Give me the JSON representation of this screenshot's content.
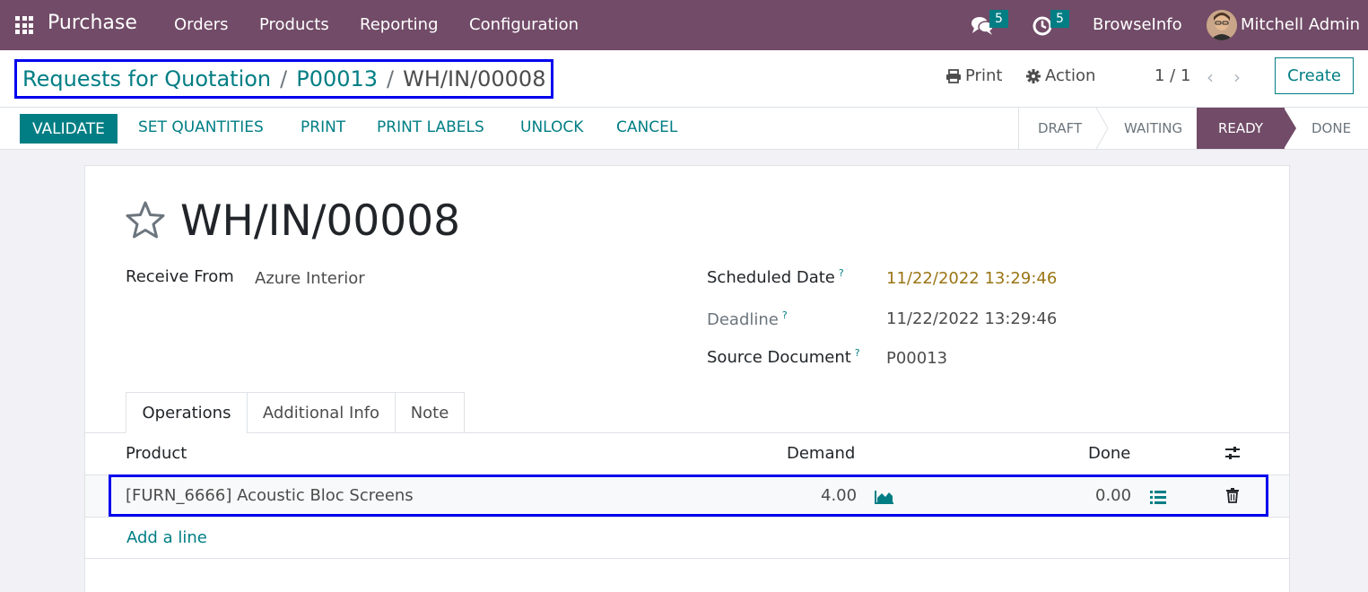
{
  "navbar": {
    "app_name": "Purchase",
    "menu": [
      "Orders",
      "Products",
      "Reporting",
      "Configuration"
    ],
    "messages_count": "5",
    "activities_count": "5",
    "company": "BrowseInfo",
    "user": "Mitchell Admin"
  },
  "breadcrumb": {
    "items": [
      "Requests for Quotation",
      "P00013"
    ],
    "current": "WH/IN/00008",
    "separator": "/"
  },
  "control_panel": {
    "print_label": "Print",
    "action_label": "Action",
    "pager": "1 / 1",
    "create_label": "Create"
  },
  "statusbar": {
    "buttons": {
      "validate": "VALIDATE",
      "set_quantities": "SET QUANTITIES",
      "print": "PRINT",
      "print_labels": "PRINT LABELS",
      "unlock": "UNLOCK",
      "cancel": "CANCEL"
    },
    "stages": [
      "DRAFT",
      "WAITING",
      "READY",
      "DONE"
    ],
    "current_stage": "READY"
  },
  "record": {
    "title": "WH/IN/00008",
    "fields": {
      "receive_from_label": "Receive From",
      "receive_from": "Azure Interior",
      "scheduled_date_label": "Scheduled Date",
      "scheduled_date": "11/22/2022 13:29:46",
      "deadline_label": "Deadline",
      "deadline": "11/22/2022 13:29:46",
      "source_document_label": "Source Document",
      "source_document": "P00013",
      "help_mark": "?"
    }
  },
  "tabs": [
    "Operations",
    "Additional Info",
    "Note"
  ],
  "table": {
    "columns": [
      "Product",
      "Demand",
      "Done"
    ],
    "rows": [
      {
        "product": "[FURN_6666] Acoustic Bloc Screens",
        "demand": "4.00",
        "done": "0.00"
      }
    ],
    "add_line": "Add a line"
  },
  "colors": {
    "brand": "#714b67",
    "accent": "#017e84",
    "highlight_box": "#0000ee",
    "scheduled_warning": "#9a7515"
  },
  "icons": [
    "apps-grid-icon",
    "chat-icon",
    "clock-icon",
    "printer-icon",
    "gear-icon",
    "chevron-left-icon",
    "chevron-right-icon",
    "star-icon",
    "area-chart-icon",
    "list-icon",
    "trash-icon",
    "settings-sliders-icon"
  ]
}
